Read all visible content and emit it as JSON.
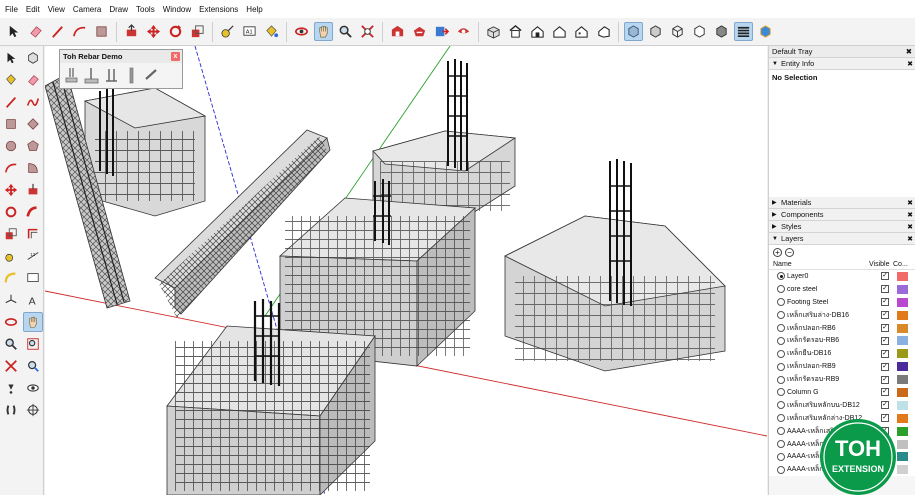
{
  "menu": [
    "File",
    "Edit",
    "View",
    "Camera",
    "Draw",
    "Tools",
    "Window",
    "Extensions",
    "Help"
  ],
  "toolbar_icons": [
    "select-icon",
    "eraser-icon",
    "line-icon",
    "arc-icon",
    "rectangle-icon",
    "push-pull-icon",
    "move-icon",
    "rotate-icon",
    "scale-icon",
    "tape-measure-icon",
    "text-icon",
    "paint-bucket-icon",
    "orbit-icon",
    "pan-icon",
    "zoom-icon",
    "zoom-extents-icon",
    "warehouse-icon",
    "extension-warehouse-icon",
    "send-to-layout-icon",
    "extension-manager-icon",
    "iso-view-icon",
    "top-view-icon",
    "front-view-icon",
    "right-view-icon",
    "back-view-icon",
    "left-view-icon",
    "xray-icon",
    "back-edges-icon",
    "wireframe-icon",
    "hidden-line-icon",
    "shaded-icon",
    "shaded-textures-icon",
    "monochrome-icon"
  ],
  "toh_toolbar": {
    "title": "Toh Rebar Demo",
    "close_label": "x"
  },
  "tray": {
    "title": "Default Tray",
    "entity_info": {
      "label": "Entity Info",
      "selection": "No Selection"
    },
    "sections": [
      "Materials",
      "Components",
      "Styles",
      "Layers"
    ],
    "layers_header": {
      "name": "Name",
      "visible": "Visible",
      "color": "Co..."
    },
    "layers": [
      {
        "name": "Layer0",
        "active": true,
        "visible": true,
        "color": "#f06a6a"
      },
      {
        "name": "core steel",
        "active": false,
        "visible": true,
        "color": "#9a6ad8"
      },
      {
        "name": "Footing Steel",
        "active": false,
        "visible": true,
        "color": "#b84ad0"
      },
      {
        "name": "เหล็กเสริมล่าง-DB16",
        "active": false,
        "visible": true,
        "color": "#e07a1a"
      },
      {
        "name": "เหล็กปลอก-RB6",
        "active": false,
        "visible": true,
        "color": "#d88a2a"
      },
      {
        "name": "เหล็กรัดรอบ-RB6",
        "active": false,
        "visible": true,
        "color": "#8ab0e0"
      },
      {
        "name": "เหล็กยืน-DB16",
        "active": false,
        "visible": true,
        "color": "#9a9a1a"
      },
      {
        "name": "เหล็กปลอก-RB9",
        "active": false,
        "visible": true,
        "color": "#4a2a9a"
      },
      {
        "name": "เหล็กรัดรอบ-RB9",
        "active": false,
        "visible": true,
        "color": "#7a7a7a"
      },
      {
        "name": "Column G",
        "active": false,
        "visible": true,
        "color": "#c86a1a"
      },
      {
        "name": "เหล็กเสริมหลักบน-DB12",
        "active": false,
        "visible": true,
        "color": "#c0e0e8"
      },
      {
        "name": "เหล็กเสริมหลักล่าง-DB12",
        "active": false,
        "visible": true,
        "color": "#e07a1a"
      },
      {
        "name": "AAAA-เหล็กเสริม...",
        "active": false,
        "visible": true,
        "color": "#2aa02a"
      },
      {
        "name": "AAAA-เหล็ก...",
        "active": false,
        "visible": true,
        "color": "#c0c0c0"
      },
      {
        "name": "AAAA-เหล็ก...",
        "active": false,
        "visible": true,
        "color": "#2a8a8a"
      },
      {
        "name": "AAAA-เหล็ก...",
        "active": false,
        "visible": true,
        "color": "#d0d0d0"
      }
    ]
  },
  "logo": {
    "line1": "TOH",
    "line2": "EXTENSION",
    "color": "#0a9a4a"
  }
}
